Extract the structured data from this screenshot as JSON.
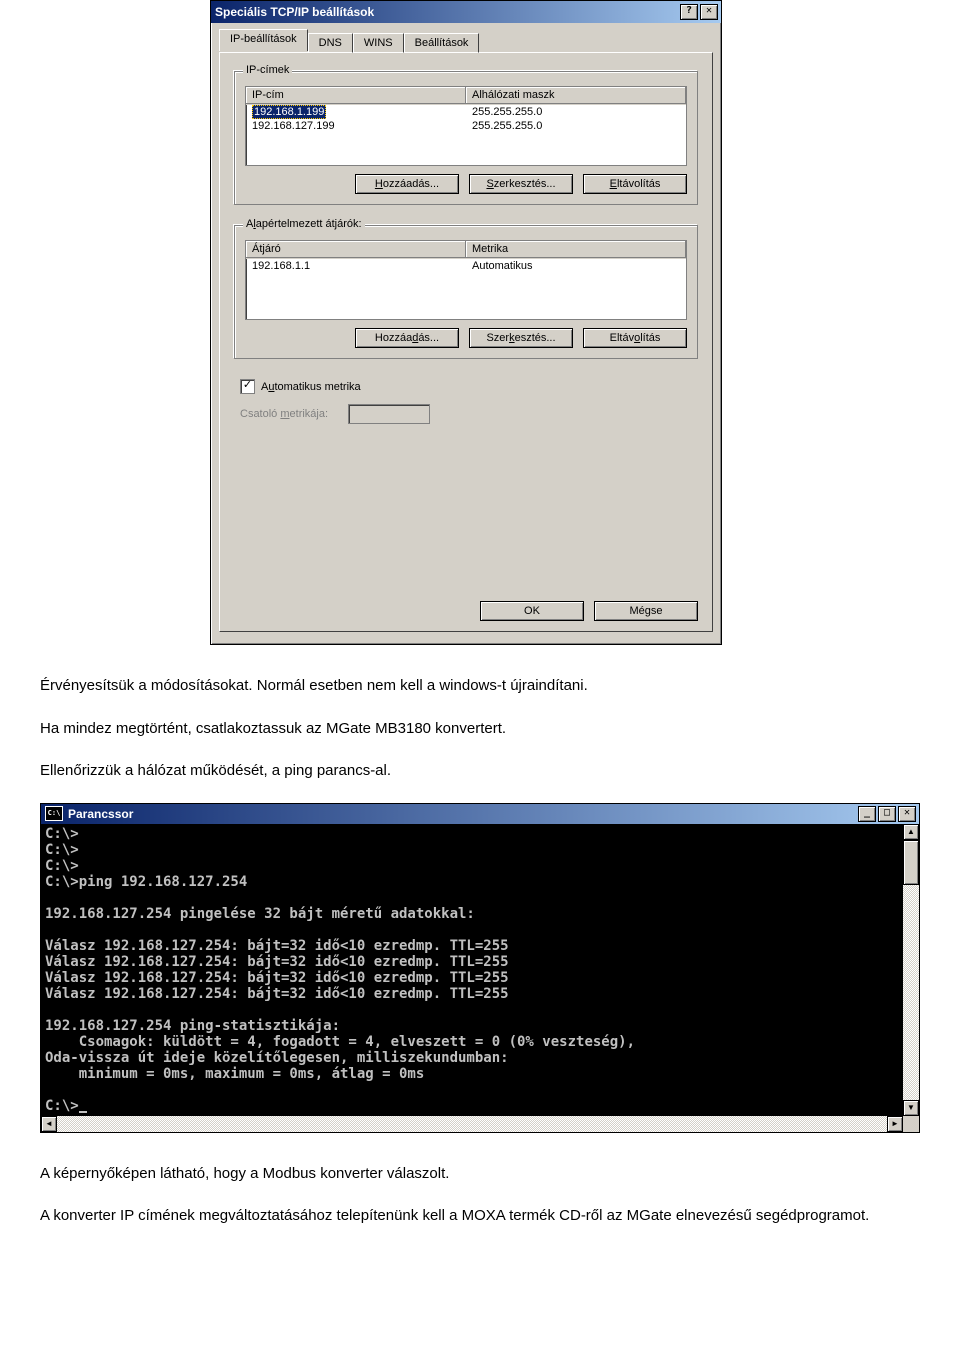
{
  "dialog": {
    "title": "Speciális TCP/IP beállítások",
    "tabs": [
      "IP-beállítások",
      "DNS",
      "WINS",
      "Beállítások"
    ],
    "ip_group": {
      "title": "IP-címek",
      "headers": [
        "IP-cím",
        "Alhálózati maszk"
      ],
      "rows": [
        {
          "ip": "192.168.1.199",
          "mask": "255.255.255.0",
          "selected": true
        },
        {
          "ip": "192.168.127.199",
          "mask": "255.255.255.0",
          "selected": false
        }
      ],
      "buttons": {
        "add": "Hozzáadás...",
        "edit": "Szerkesztés...",
        "remove": "Eltávolítás"
      }
    },
    "gw_group": {
      "title": "Alapértelmezett átjárók:",
      "headers": [
        "Átjáró",
        "Metrika"
      ],
      "rows": [
        {
          "gw": "192.168.1.1",
          "metric": "Automatikus"
        }
      ],
      "buttons": {
        "add": "Hozzáadás...",
        "edit": "Szerkesztés...",
        "remove": "Eltávolítás"
      }
    },
    "auto_metric_label": "Automatikus metrika",
    "interface_metric_label": "Csatoló metrikája:",
    "ok": "OK",
    "cancel": "Mégse"
  },
  "doc": {
    "p1": "Érvényesítsük a módosításokat. Normál esetben nem kell a windows-t újraindítani.",
    "p2": "Ha mindez megtörtént, csatlakoztassuk az MGate MB3180 konvertert.",
    "p3": "Ellenőrizzük a hálózat működését, a ping parancs-al.",
    "p4": "A képernyőképen látható, hogy a Modbus konverter válaszolt.",
    "p5": "A konverter IP címének megváltoztatásához telepítenünk kell a MOXA termék CD-ről az MGate elnevezésű segédprogramot."
  },
  "cmd": {
    "title": "Parancssor",
    "icon": "C:\\",
    "lines": "C:\\>\nC:\\>\nC:\\>\nC:\\>ping 192.168.127.254\n\n192.168.127.254 pingelése 32 bájt méretű adatokkal:\n\nVálasz 192.168.127.254: bájt=32 idő<10 ezredmp. TTL=255\nVálasz 192.168.127.254: bájt=32 idő<10 ezredmp. TTL=255\nVálasz 192.168.127.254: bájt=32 idő<10 ezredmp. TTL=255\nVálasz 192.168.127.254: bájt=32 idő<10 ezredmp. TTL=255\n\n192.168.127.254 ping-statisztikája:\n    Csomagok: küldött = 4, fogadott = 4, elveszett = 0 (0% veszteség),\nOda-vissza út ideje közelítőlegesen, milliszekundumban:\n    minimum = 0ms, maximum = 0ms, átlag = 0ms\n\nC:\\>"
  }
}
